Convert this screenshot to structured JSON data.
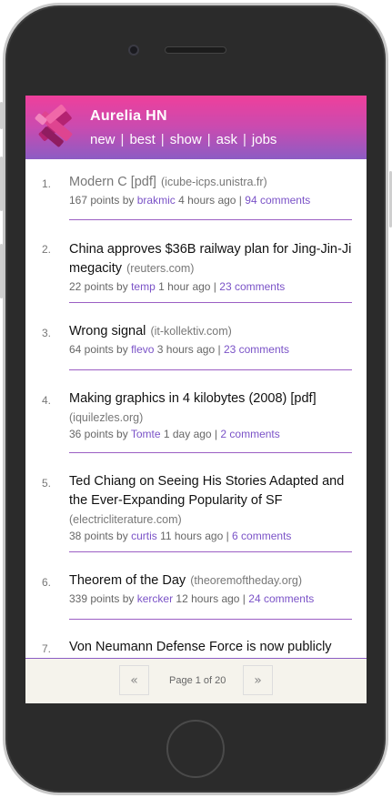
{
  "app": {
    "title": "Aurelia HN"
  },
  "nav": {
    "items": [
      "new",
      "best",
      "show",
      "ask",
      "jobs"
    ]
  },
  "stories": [
    {
      "rank": "1.",
      "title": "Modern C [pdf]",
      "domain": "(icube-icps.unistra.fr)",
      "points": "167 points by",
      "user": "brakmic",
      "time": "4 hours ago |",
      "comments": "94 comments"
    },
    {
      "rank": "2.",
      "title": "China approves $36B railway plan for Jing-Jin-Ji megacity",
      "domain": "(reuters.com)",
      "points": "22 points by",
      "user": "temp",
      "time": "1 hour ago |",
      "comments": "23 comments"
    },
    {
      "rank": "3.",
      "title": "Wrong signal",
      "domain": "(it-kollektiv.com)",
      "points": "64 points by",
      "user": "flevo",
      "time": "3 hours ago |",
      "comments": "23 comments"
    },
    {
      "rank": "4.",
      "title": "Making graphics in 4 kilobytes (2008) [pdf]",
      "domain": "(iquilezles.org)",
      "points": "36 points by",
      "user": "Tomte",
      "time": "1 day ago |",
      "comments": "2 comments"
    },
    {
      "rank": "5.",
      "title": "Ted Chiang on Seeing His Stories Adapted and the Ever-Expanding Popularity of SF",
      "domain": "(electricliterature.com)",
      "points": "38 points by",
      "user": "curtis",
      "time": "11 hours ago |",
      "comments": "6 comments"
    },
    {
      "rank": "6.",
      "title": "Theorem of the Day",
      "domain": "(theoremoftheday.org)",
      "points": "339 points by",
      "user": "kercker",
      "time": "12 hours ago |",
      "comments": "24 comments"
    },
    {
      "rank": "7.",
      "title": "Von Neumann Defense Force is now publicly"
    }
  ],
  "pagination": {
    "prev": "«",
    "next": "»",
    "label": "Page 1 of 20"
  }
}
